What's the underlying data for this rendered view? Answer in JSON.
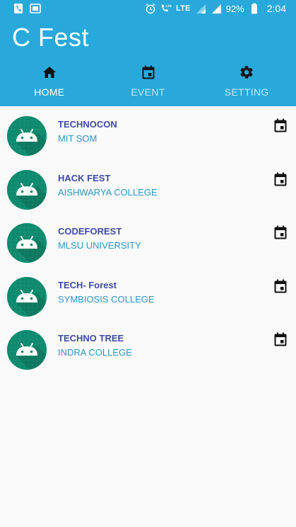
{
  "status_bar": {
    "left_icons": [
      "phone-icon",
      "screen-icon"
    ],
    "right_icons": [
      "alarm-icon",
      "volte-call-icon",
      "lte-signal-icon",
      "signal-icon"
    ],
    "lte_label": "LTE",
    "battery_pct": "92%",
    "time": "2:04"
  },
  "header": {
    "title": "C Fest",
    "tabs": [
      {
        "label": "HOME",
        "icon": "home-icon",
        "active": true
      },
      {
        "label": "EVENT",
        "icon": "calendar-icon",
        "active": false
      },
      {
        "label": "SETTING",
        "icon": "gear-icon",
        "active": false
      }
    ]
  },
  "events": [
    {
      "title": "TECHNOCON",
      "subtitle": "MIT SOM"
    },
    {
      "title": "HACK FEST",
      "subtitle": "AISHWARYA COLLEGE"
    },
    {
      "title": "CODEFOREST",
      "subtitle": "MLSU UNIVERSITY"
    },
    {
      "title": "TECH- Forest",
      "subtitle": "SYMBIOSIS COLLEGE"
    },
    {
      "title": "TECHNO TREE",
      "subtitle": "INDRA COLLEGE"
    }
  ],
  "colors": {
    "primary": "#29a9db",
    "avatar_bg": "#0c8a6d",
    "title_text": "#3f4aa8",
    "subtitle_text": "#2b97c8",
    "background": "#fafafa"
  }
}
